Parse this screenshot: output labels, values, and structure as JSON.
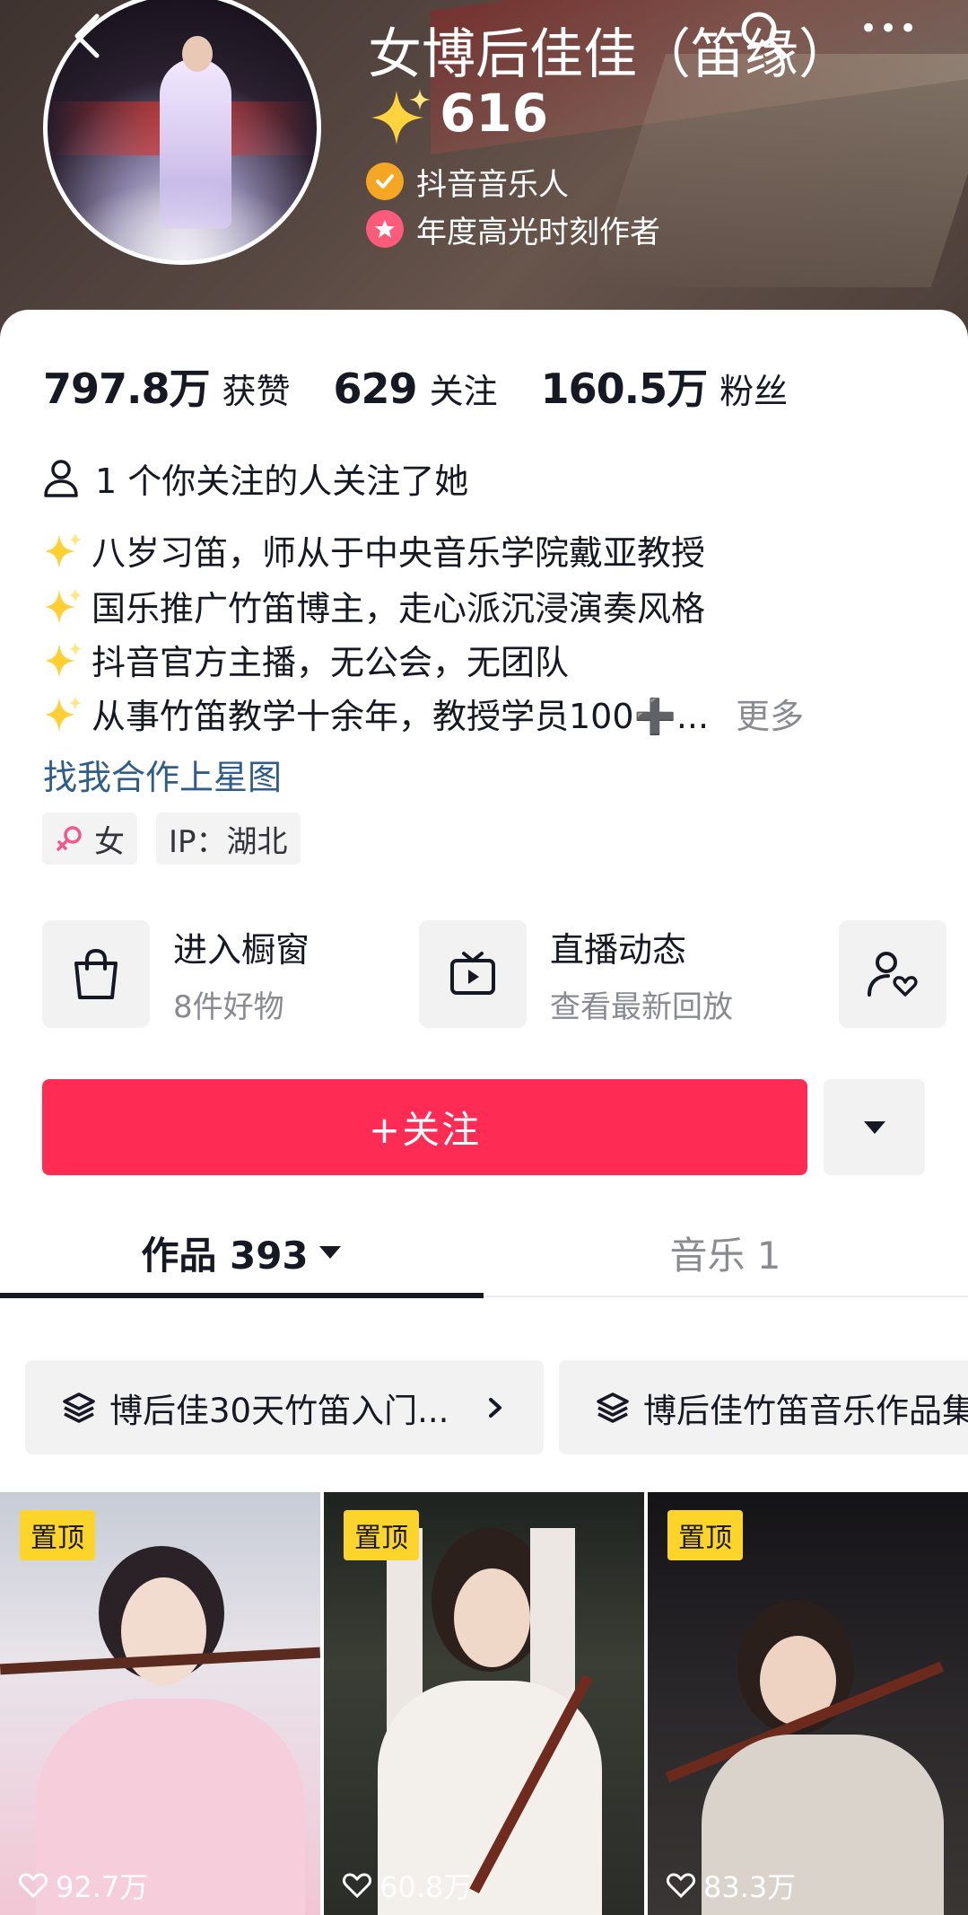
{
  "header": {
    "name": "女博后佳佳（笛缘）",
    "likes_badge": "616",
    "badges": [
      {
        "label": "抖音音乐人",
        "icon": "verified-check-icon",
        "color": "#f5a623"
      },
      {
        "label": "年度高光时刻作者",
        "icon": "star-badge-icon",
        "color": "#fe5a7a"
      }
    ]
  },
  "stats": [
    {
      "value": "797.8万",
      "label": "获赞"
    },
    {
      "value": "629",
      "label": "关注"
    },
    {
      "value": "160.5万",
      "label": "粉丝"
    }
  ],
  "mutual": "1 个你关注的人关注了她",
  "bio": [
    "八岁习笛，师从于中央音乐学院戴亚教授",
    "国乐推广竹笛博主，走心派沉浸演奏风格",
    "抖音官方主播，无公会，无团队",
    "从事竹笛教学十余年，教授学员100➕..."
  ],
  "bio_more": "更多",
  "collab_link": "找我合作上星图",
  "tags": {
    "gender": "女",
    "ip": "IP：湖北"
  },
  "entries": [
    {
      "title": "进入橱窗",
      "sub": "8件好物",
      "icon": "shopping-bag-icon"
    },
    {
      "title": "直播动态",
      "sub": "查看最新回放",
      "icon": "tv-icon"
    }
  ],
  "follow_label": "+关注",
  "tabs": [
    {
      "label": "作品 393",
      "active": true
    },
    {
      "label": "音乐 1",
      "active": false
    }
  ],
  "collections": [
    "博后佳30天竹笛入门...",
    "博后佳竹笛音乐作品集"
  ],
  "videos": [
    {
      "pin": "置顶",
      "likes": "92.7万",
      "colors": [
        "#d7d9e0",
        "#f2c9d6"
      ]
    },
    {
      "pin": "置顶",
      "likes": "60.8万",
      "colors": [
        "#2c2f2a",
        "#e7e2dc"
      ]
    },
    {
      "pin": "置顶",
      "likes": "83.3万",
      "colors": [
        "#1b1a1c",
        "#c9c4bd"
      ]
    }
  ],
  "colors": {
    "accent": "#fe2c55",
    "pin": "#fdd52a",
    "link": "#2f5d8a"
  }
}
